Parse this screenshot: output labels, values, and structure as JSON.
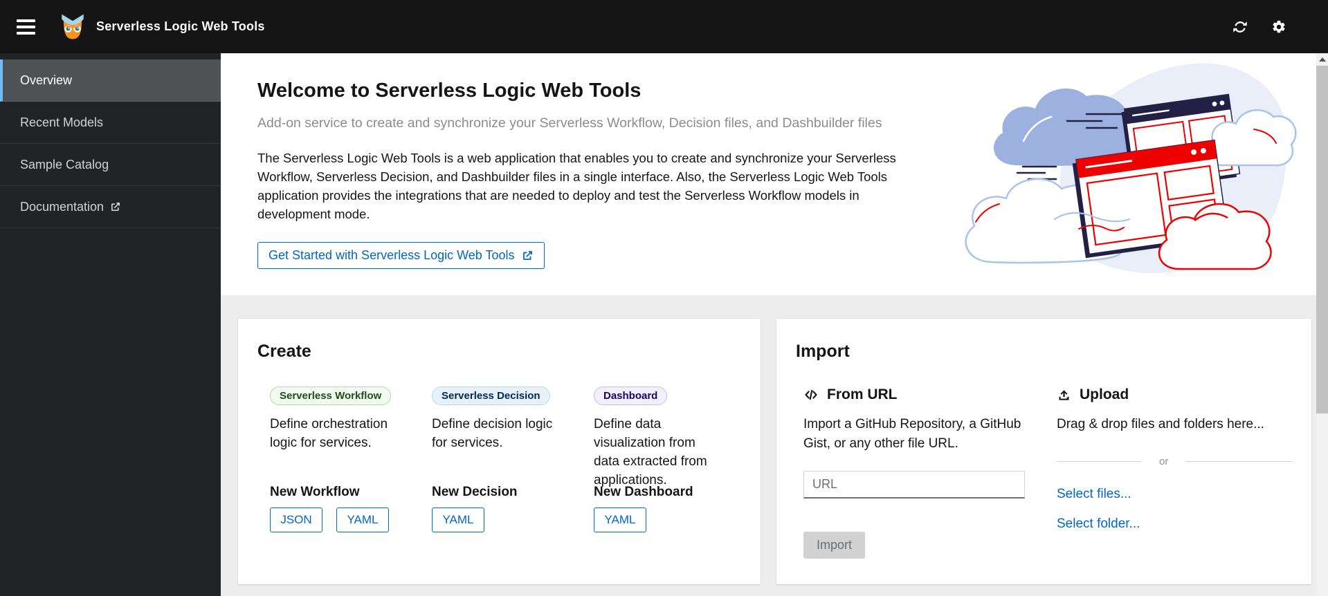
{
  "header": {
    "title": "Serverless Logic Web Tools",
    "icons": [
      "menu-icon",
      "owl-logo-icon",
      "sync-icon",
      "gear-icon"
    ]
  },
  "sidebar": {
    "items": [
      {
        "label": "Overview",
        "selected": true,
        "external_link": false
      },
      {
        "label": "Recent Models",
        "selected": false,
        "external_link": false
      },
      {
        "label": "Sample Catalog",
        "selected": false,
        "external_link": false
      },
      {
        "label": "Documentation",
        "selected": false,
        "external_link": true
      }
    ]
  },
  "welcome": {
    "title": "Welcome to Serverless Logic Web Tools",
    "subtitle": "Add-on service to create and synchronize your Serverless Workflow, Decision files, and Dashbuilder files",
    "description": "The Serverless Logic Web Tools is a web application that enables you to create and synchronize your Serverless Workflow, Serverless Decision, and Dashbuilder files in a single interface. Also, the Serverless Logic Web Tools application provides the integrations that are needed to deploy and test the Serverless Workflow models in development mode.",
    "get_started_label": "Get Started with Serverless Logic Web Tools"
  },
  "create_card": {
    "title": "Create",
    "columns": [
      {
        "badge": "Serverless Workflow",
        "badge_color": "green",
        "description": "Define orchestration logic for services.",
        "new_label": "New Workflow",
        "buttons": [
          "JSON",
          "YAML"
        ]
      },
      {
        "badge": "Serverless Decision",
        "badge_color": "blue",
        "description": "Define decision logic for services.",
        "new_label": "New Decision",
        "buttons": [
          "YAML"
        ]
      },
      {
        "badge": "Dashboard",
        "badge_color": "purple",
        "description": "Define data visualization from data extracted from applications.",
        "new_label": "New Dashboard",
        "buttons": [
          "YAML"
        ]
      }
    ]
  },
  "import_card": {
    "title": "Import",
    "from_url": {
      "heading": "From URL",
      "description": "Import a GitHub Repository, a GitHub Gist, or any other file URL.",
      "url_placeholder": "URL",
      "url_value": "",
      "import_button": "Import",
      "import_button_disabled": true
    },
    "upload": {
      "heading": "Upload",
      "description": "Drag & drop files and folders here...",
      "or_label": "or",
      "select_files": "Select files...",
      "select_folder": "Select folder..."
    }
  },
  "colors": {
    "accent_blue": "#0066cc",
    "header_bg": "#151515",
    "sidebar_bg": "#212427",
    "sidebar_selected_bg": "#4f5255",
    "sidebar_selected_border": "#73bcf7",
    "badge_green_bg": "#f3faf2",
    "badge_green_border": "#afd9a8",
    "badge_green_text": "#1e4f18",
    "badge_blue_bg": "#e7f1fa",
    "badge_blue_border": "#b6d8f1",
    "badge_blue_text": "#002952",
    "badge_purple_bg": "#f2f0fc",
    "badge_purple_border": "#c6bdf2",
    "badge_purple_text": "#1f0066",
    "disabled_button_bg": "#d2d2d2",
    "disabled_button_text": "#6a6e73"
  }
}
